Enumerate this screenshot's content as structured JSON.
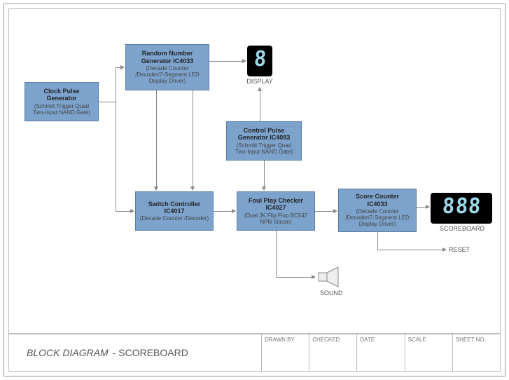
{
  "diagram": {
    "title_italic": "BLOCK DIAGRAM",
    "title_rest": " - SCOREBOARD",
    "blocks": {
      "clock": {
        "title": "Clock Pulse\nGenerator",
        "sub": "(Schmitt Trigger Quad\nTwo-Input NAND Gate)"
      },
      "rng": {
        "title": "Random Number\nGenerator IC4033",
        "sub": "(Decade Counter\n/Decoder/7-Segment LED\nDisplay Driver)"
      },
      "cpg": {
        "title": "Control Pulse\nGenerator IC4093",
        "sub": "(Schmitt Trigger Quad\nTwo-Input NAND Gate)"
      },
      "switch": {
        "title": "Switch Controller\nIC4017",
        "sub": "(Decade Counter /Decoder)"
      },
      "foul": {
        "title": "Foul Play Checker\nIC4027",
        "sub": "(Dual JK Flip Flop BC547\nNPN Silicon)"
      },
      "score": {
        "title": "Score Counter\nIC4033",
        "sub": "(Decade Counter\n/Decoder/7-Segment LED\nDisplay Driver)"
      }
    },
    "labels": {
      "display": "DISPLAY",
      "scoreboard": "SCOREBOARD",
      "reset": "RESET",
      "sound": "SOUND"
    },
    "displays": {
      "single": "8",
      "triple": "888"
    },
    "footer": {
      "drawn_by": "DRAWN BY",
      "checked": "CHECKED",
      "date": "DATE",
      "scale": "SCALE",
      "sheet_no": "SHEET NO."
    }
  }
}
